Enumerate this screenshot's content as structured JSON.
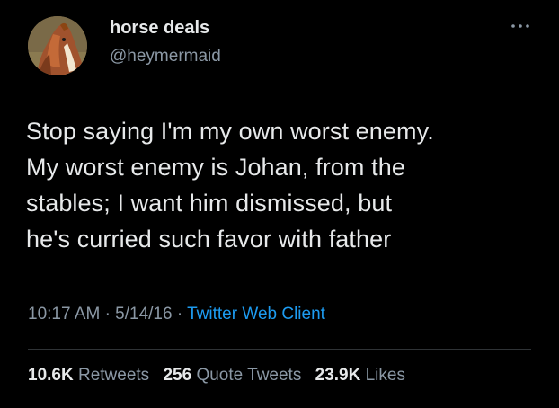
{
  "author": {
    "name": "horse deals",
    "handle": "@heymermaid",
    "avatar_icon": "horse-avatar"
  },
  "more_icon": "more-horizontal-icon",
  "tweet": {
    "lines": [
      "Stop saying I'm my own worst enemy.",
      "My worst enemy is Johan, from the",
      "stables; I want him dismissed, but",
      "he's curried such favor with father"
    ]
  },
  "meta": {
    "time": "10:17 AM",
    "separator": "·",
    "date": "5/14/16",
    "client": "Twitter Web Client"
  },
  "stats": {
    "retweets_count": "10.6K",
    "retweets_label": "Retweets",
    "quotes_count": "256",
    "quotes_label": "Quote Tweets",
    "likes_count": "23.9K",
    "likes_label": "Likes"
  },
  "colors": {
    "background": "#000000",
    "primary_text": "#e7e9ea",
    "secondary_text": "#8b98a5",
    "link": "#1d9bf0",
    "divider": "#2f3336"
  }
}
